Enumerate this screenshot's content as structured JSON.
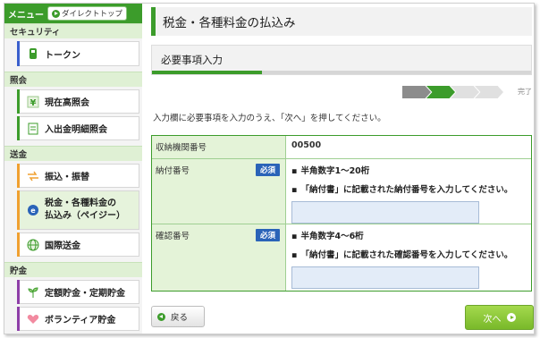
{
  "sidebar": {
    "menu_label": "メニュー",
    "direct_top_label": "ダイレクトトップ",
    "sections": {
      "security": "セキュリティ",
      "inquiry": "照会",
      "remittance": "送金",
      "savings": "貯金"
    },
    "items": {
      "token": "トークン",
      "balance": "現在高照会",
      "statement": "入出金明細照会",
      "transfer": "振込・振替",
      "tax_line1": "税金・各種料金の",
      "tax_line2": "払込み（ペイジー）",
      "intl": "国際送金",
      "fixed": "定額貯金・定期貯金",
      "volunteer": "ボランティア貯金"
    }
  },
  "header": {
    "title": "税金・各種料金の払込み"
  },
  "step": {
    "title": "必要事項入力",
    "progress": 0.29,
    "end_label": "完了"
  },
  "instruction": "入力欄に必要事項を入力のうえ、「次へ」を押してください。",
  "form": {
    "institution_label": "収納機関番号",
    "institution_value": "00500",
    "payment_label": "納付番号",
    "required": "必須",
    "payment_hint1": "半角数字1～20桁",
    "payment_hint2": "「納付書」に記載された納付番号を入力してください。",
    "confirm_label": "確認番号",
    "confirm_hint1": "半角数字4～6桁",
    "confirm_hint2": "「納付書」に記載された確認番号を入力してください。"
  },
  "buttons": {
    "back": "戻る",
    "next": "次へ"
  },
  "colors": {
    "accent": "#3c9c2b",
    "required_badge": "#2a63b8",
    "next_button": "#79b92a"
  }
}
